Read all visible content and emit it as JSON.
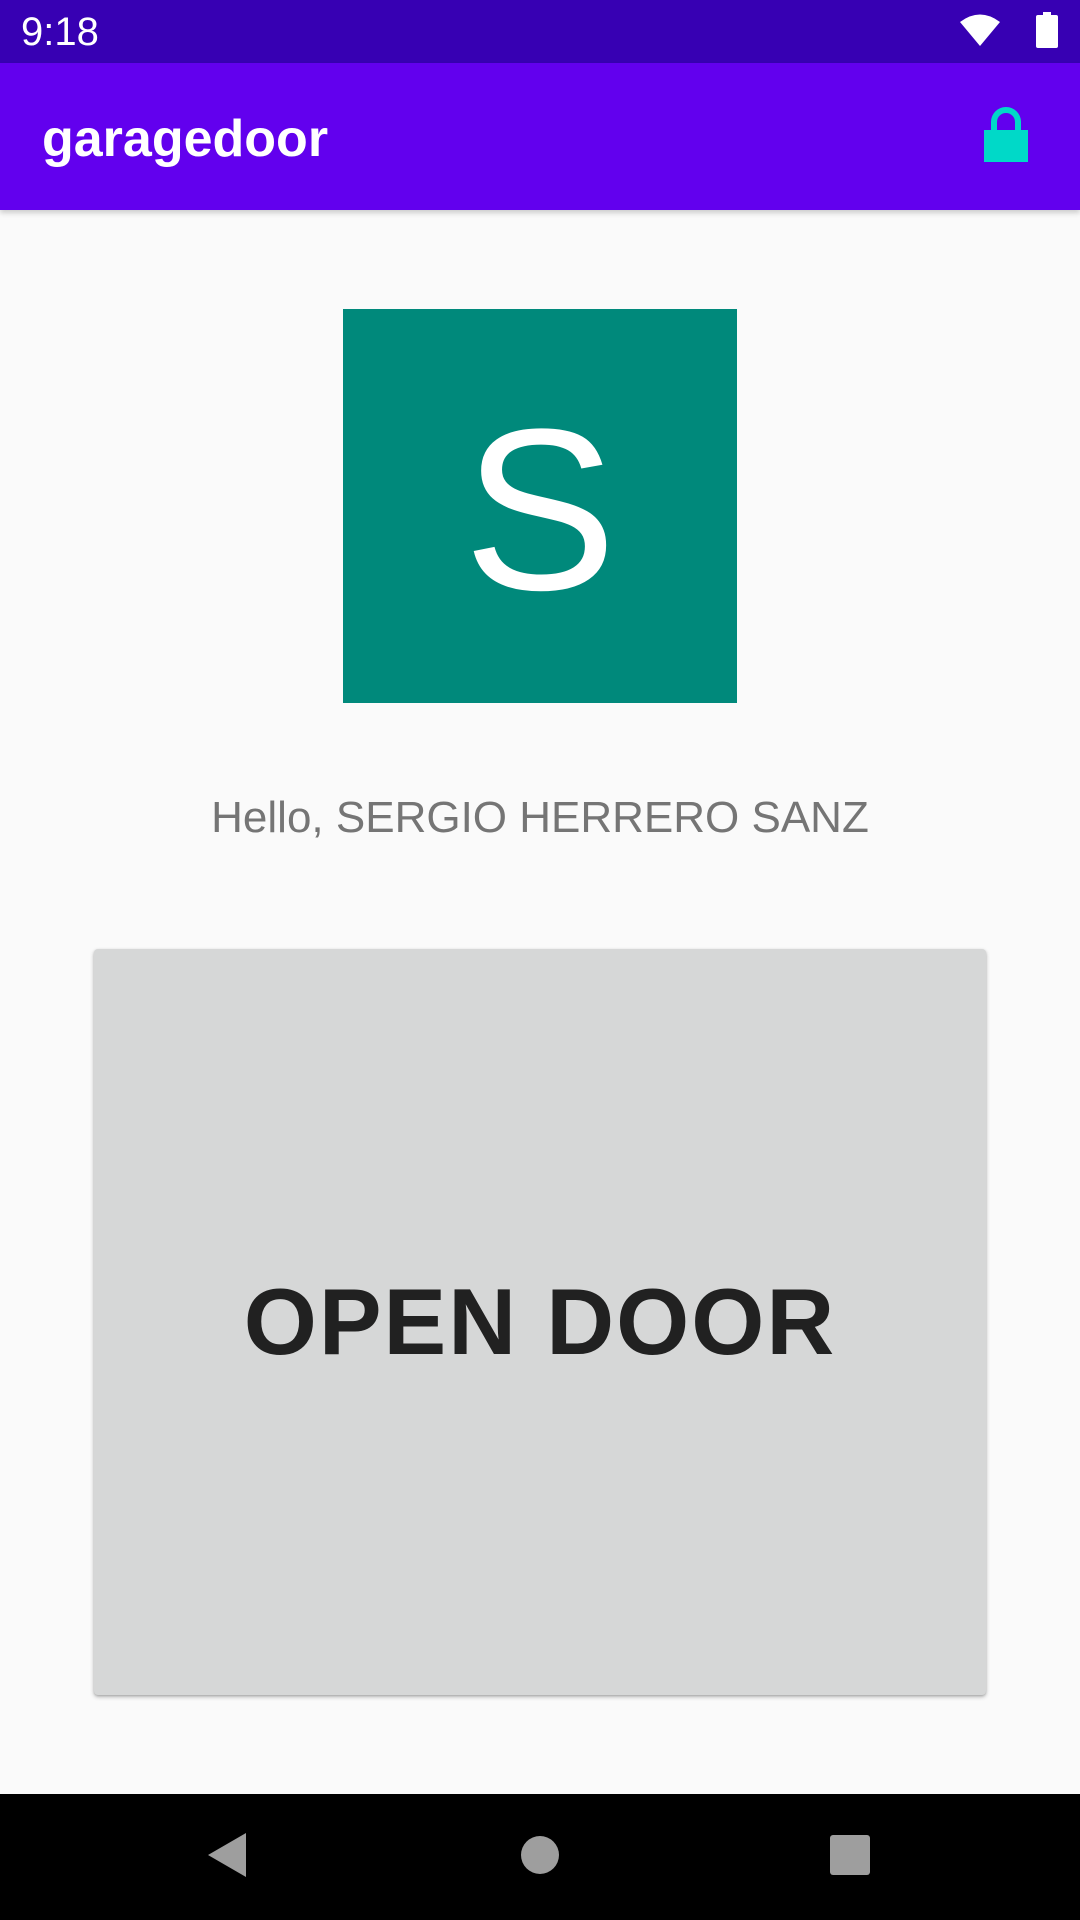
{
  "status_bar": {
    "time": "9:18",
    "icons": [
      "wifi-icon",
      "battery-icon"
    ]
  },
  "app_bar": {
    "title": "garagedoor",
    "action_icon": "lock-icon",
    "action_color": "#00d9c8"
  },
  "profile": {
    "avatar_letter": "S",
    "avatar_color": "#00897b",
    "greeting": "Hello, SERGIO HERRERO SANZ"
  },
  "main_action": {
    "label": "OPEN DOOR"
  },
  "nav_bar": {
    "buttons": [
      "back-icon",
      "home-icon",
      "recents-icon"
    ]
  },
  "colors": {
    "status_bar": "#3700b3",
    "app_bar": "#6200ee",
    "background": "#fafafa",
    "button": "#d6d7d7"
  }
}
